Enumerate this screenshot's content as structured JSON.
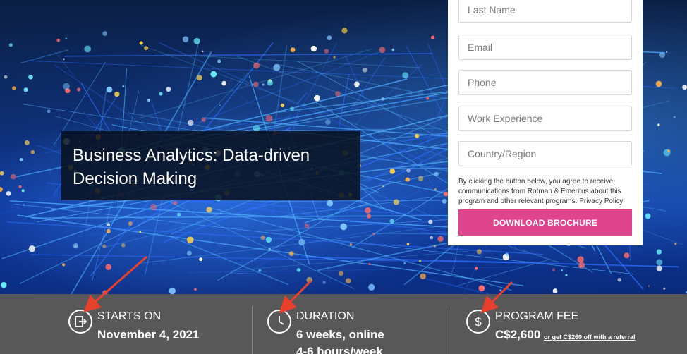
{
  "hero": {
    "title": "Business Analytics: Data-driven Decision Making"
  },
  "form": {
    "fields": [
      {
        "placeholder": "Last Name"
      },
      {
        "placeholder": "Email"
      },
      {
        "placeholder": "Phone"
      },
      {
        "placeholder": "Work Experience"
      },
      {
        "placeholder": "Country/Region"
      }
    ],
    "consent_text": "By clicking the button below, you agree to receive communications from Rotman & Emeritus about this program and other relevant programs. Privacy Policy",
    "button_label": "DOWNLOAD BROCHURE",
    "button_color": "#e0448d"
  },
  "info_bar": {
    "starts": {
      "label": "STARTS ON",
      "value": "November 4, 2021",
      "icon": "exit-arrow-icon"
    },
    "duration": {
      "label": "DURATION",
      "value": "6 weeks, online",
      "value2": "4-6 hours/week",
      "icon": "clock-icon"
    },
    "fee": {
      "label": "PROGRAM FEE",
      "value": "C$2,600",
      "referral": "or get C$260 off with a referral",
      "icon": "dollar-icon"
    }
  },
  "annotations": {
    "arrow_color": "#e8402a"
  }
}
